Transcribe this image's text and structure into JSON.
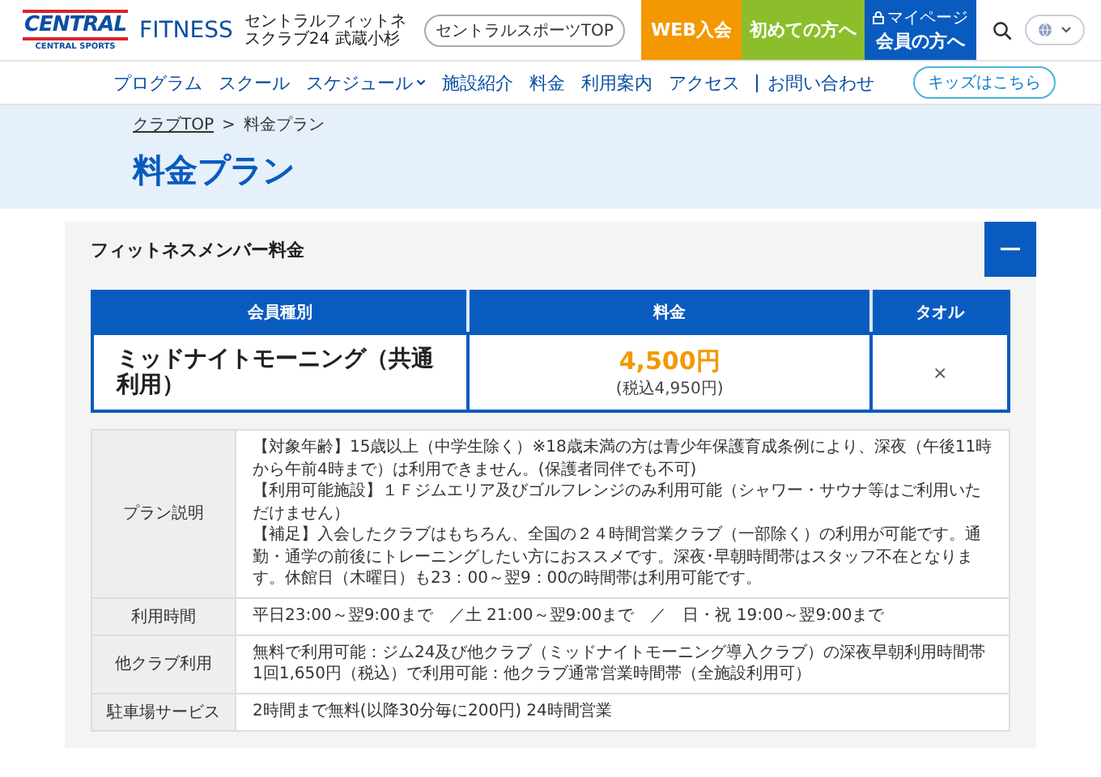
{
  "header": {
    "logo": {
      "wordmark": "CENTRAL",
      "subtitle": "CENTRAL SPORTS"
    },
    "brand": "FITNESS",
    "club_name": "セントラルフィットネスクラブ24 武蔵小杉",
    "top_link": "セントラルスポーツTOP",
    "buttons": [
      {
        "kind": "join",
        "label": "WEB入会"
      },
      {
        "kind": "first",
        "label": "初めての方へ"
      },
      {
        "kind": "member",
        "caption": "マイページ",
        "label": "会員の方へ"
      }
    ]
  },
  "nav": {
    "items": [
      {
        "label": "プログラム",
        "dropdown": false,
        "separated": false
      },
      {
        "label": "スクール",
        "dropdown": false,
        "separated": false
      },
      {
        "label": "スケジュール",
        "dropdown": true,
        "separated": false
      },
      {
        "label": "施設紹介",
        "dropdown": false,
        "separated": false
      },
      {
        "label": "料金",
        "dropdown": false,
        "separated": false
      },
      {
        "label": "利用案内",
        "dropdown": false,
        "separated": false
      },
      {
        "label": "アクセス",
        "dropdown": false,
        "separated": false
      },
      {
        "label": "お問い合わせ",
        "dropdown": false,
        "separated": true
      }
    ],
    "kids_button": "キッズはこちら"
  },
  "breadcrumb": {
    "items": [
      {
        "label": "クラブTOP",
        "link": true
      },
      {
        "label": "料金プラン",
        "link": false
      }
    ],
    "separator": ">"
  },
  "title": "料金プラン",
  "panel": {
    "title": "フィットネスメンバー料金",
    "expanded": true,
    "price_table": {
      "columns": [
        "会員種別",
        "料金",
        "タオル"
      ],
      "rows": [
        {
          "plan": "ミッドナイトモーニング（共通利用）",
          "price": "4,500円",
          "price_with_tax": "(税込4,950円)",
          "towel": "×"
        }
      ]
    },
    "details": [
      {
        "label": "プラン説明",
        "lines": [
          "【対象年齢】15歳以上（中学生除く）※18歳未満の方は青少年保護育成条例により、深夜（午後11時から午前4時まで）は利用できません。(保護者同伴でも不可)",
          "【利用可能施設】１Ｆジムエリア及びゴルフレンジのみ利用可能（シャワー・サウナ等はご利用いただけません）",
          "【補足】入会したクラブはもちろん、全国の２４時間営業クラブ（一部除く）の利用が可能です。通勤・通学の前後にトレーニングしたい方におススメです。深夜･早朝時間帯はスタッフ不在となります。休館日（木曜日）も23：00～翌9：00の時間帯は利用可能です。"
        ]
      },
      {
        "label": "利用時間",
        "lines": [
          "平日23:00～翌9:00まで　／土 21:00～翌9:00まで　／　日・祝 19:00～翌9:00まで"
        ]
      },
      {
        "label": "他クラブ利用",
        "lines": [
          "無料で利用可能：ジム24及び他クラブ（ミッドナイトモーニング導入クラブ）の深夜早朝利用時間帯",
          "1回1,650円（税込）で利用可能：他クラブ通常営業時間帯（全施設利用可）"
        ]
      },
      {
        "label": "駐車場サービス",
        "lines": [
          "2時間まで無料(以降30分毎に200円) 24時間営業"
        ]
      }
    ]
  }
}
